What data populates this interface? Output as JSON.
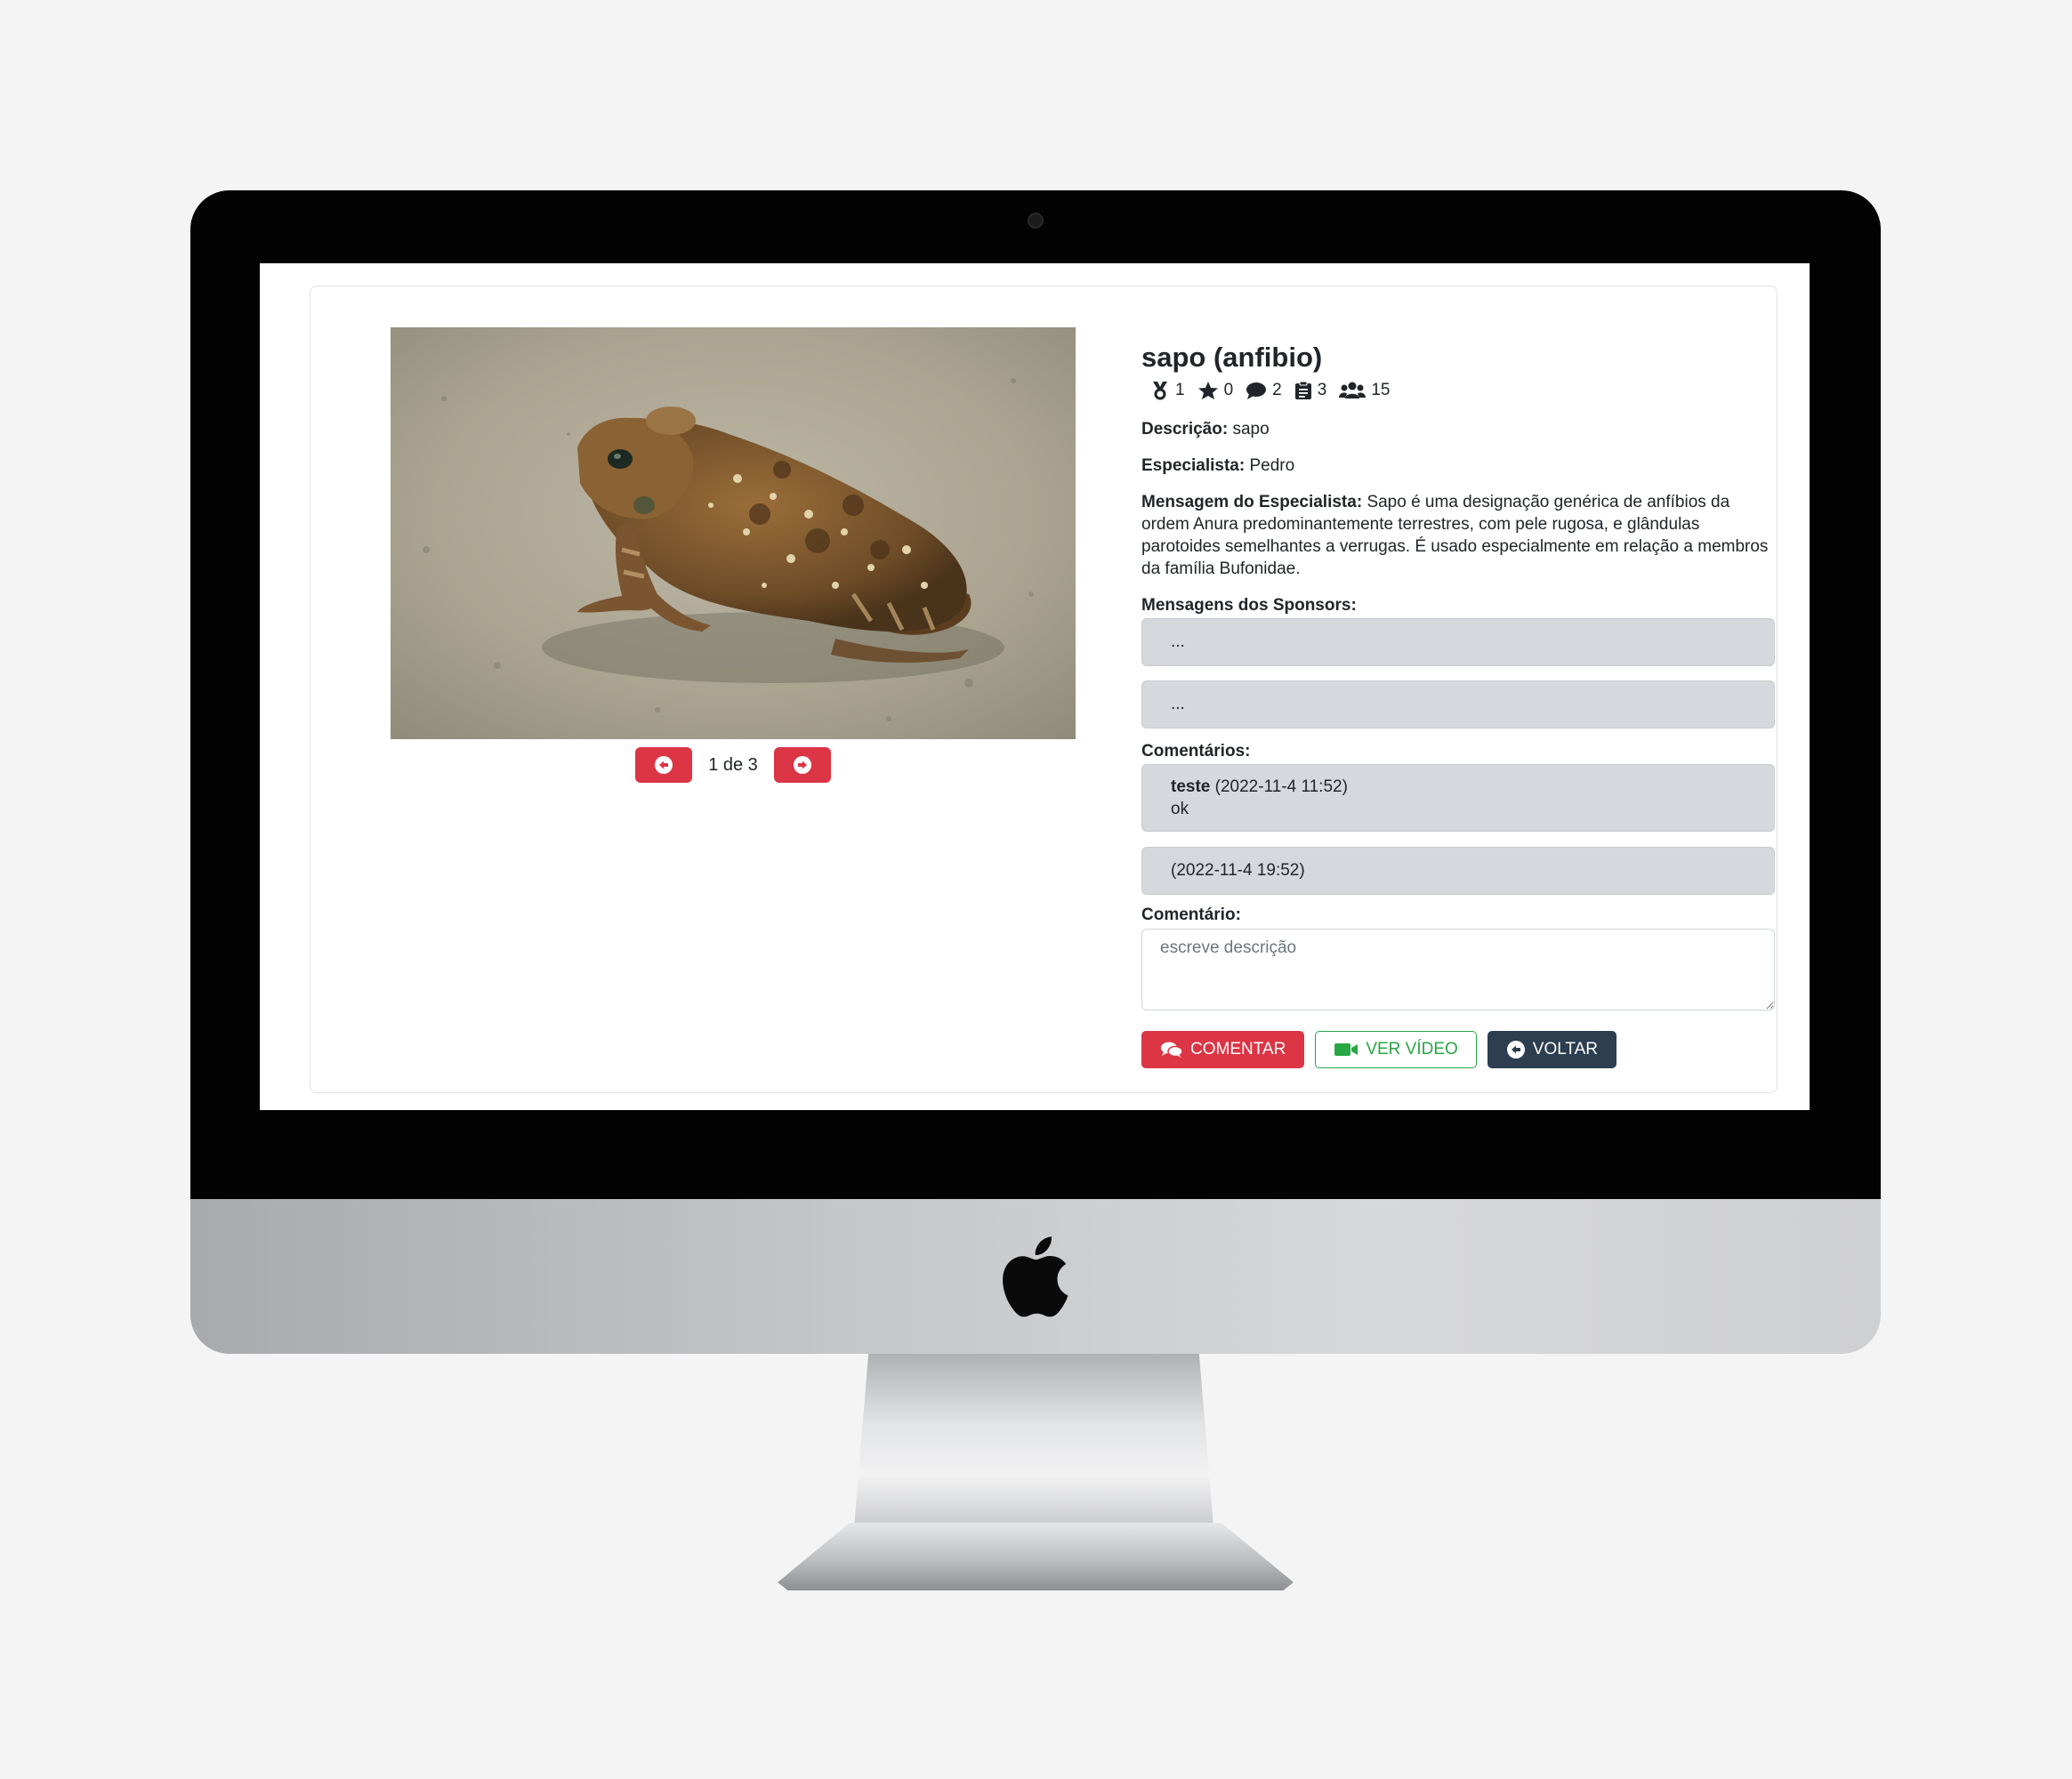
{
  "page": {
    "title": "sapo (anfibio)",
    "stats": [
      {
        "icon": "medal-icon",
        "value": "1"
      },
      {
        "icon": "star-icon",
        "value": "0"
      },
      {
        "icon": "comment-icon",
        "value": "2"
      },
      {
        "icon": "clipboard-icon",
        "value": "3"
      },
      {
        "icon": "users-icon",
        "value": "15"
      }
    ],
    "descricao": {
      "label": "Descrição:",
      "value": "sapo"
    },
    "especialista": {
      "label": "Especialista:",
      "value": "Pedro"
    },
    "mensagem_especialista": {
      "label": "Mensagem do Especialista:",
      "value": "Sapo é uma designação genérica de anfíbios da ordem Anura predominantemente terrestres, com pele rugosa, e glândulas parotoides semelhantes a verrugas. É usado especialmente em relação a membros da família Bufonidae."
    },
    "sponsors": {
      "label": "Mensagens dos Sponsors:",
      "messages": [
        "...",
        "..."
      ]
    },
    "comentarios": {
      "label": "Comentários:",
      "items": [
        {
          "author": "teste",
          "date": "(2022-11-4 11:52)",
          "text": "ok"
        },
        {
          "author": "",
          "date": "(2022-11-4 19:52)",
          "text": ""
        }
      ]
    },
    "comentario_input": {
      "label": "Comentário:",
      "placeholder": "escreve descrição",
      "value": ""
    },
    "pager": {
      "label": "1 de 3"
    },
    "buttons": {
      "comentar": "COMENTAR",
      "ver_video": "VER VÍDEO",
      "voltar": "VOLTAR"
    }
  },
  "colors": {
    "primary_red": "#dc3545",
    "success_green": "#28a745",
    "dark": "#2c3e50",
    "message_bg": "#d5d8dc"
  }
}
